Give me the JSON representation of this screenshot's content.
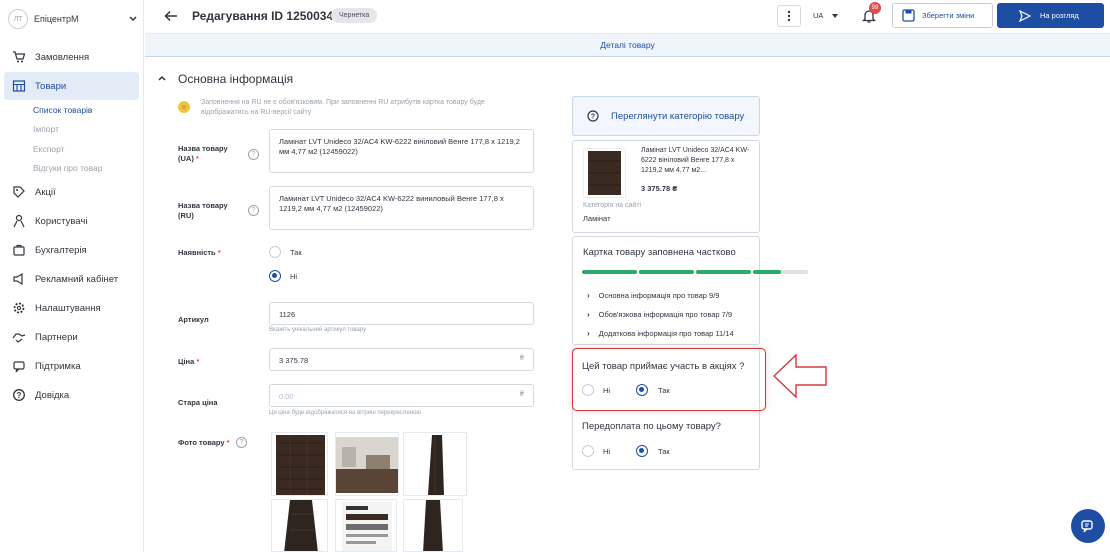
{
  "sidebar": {
    "avatar_initials": "ЛТ",
    "account_name": "ЕпіцентрМ",
    "items": [
      {
        "label": "Замовлення",
        "icon": "cart-icon"
      },
      {
        "label": "Товари",
        "icon": "catalog-icon"
      },
      {
        "label": "Акції",
        "icon": "discount-icon"
      },
      {
        "label": "Користувачі",
        "icon": "users-icon"
      },
      {
        "label": "Бухгалтерія",
        "icon": "accounting-icon"
      },
      {
        "label": "Рекламний кабінет",
        "icon": "megaphone-icon"
      },
      {
        "label": "Налаштування",
        "icon": "gear-icon"
      },
      {
        "label": "Партнери",
        "icon": "handshake-icon"
      },
      {
        "label": "Підтримка",
        "icon": "support-icon"
      },
      {
        "label": "Довідка",
        "icon": "help-icon"
      }
    ],
    "subitems": [
      "Список товарів",
      "Імпорт",
      "Експорт",
      "Відгуки про товар"
    ]
  },
  "header": {
    "title": "Редагування ID 12500348",
    "status_badge": "Чернетка",
    "lang": "UA",
    "notif_count": "99",
    "save_label": "Зберегти зміни",
    "submit_label": "На розгляд"
  },
  "tab": {
    "label": "Деталі товару"
  },
  "form": {
    "section_title": "Основна інформація",
    "ru_note": "Заповнення на RU не є обов'язковим. При заповненні RU атрибутів картка товару буде відображатись на RU-версії сайту",
    "name_ua_label": "Назва товару (UA)",
    "name_ua_value": "Ламінат LVT Unideco 32/AC4 KW-6222 вініловий Венге 177,8 х 1219,2 мм 4,77 м2 (12459022)",
    "name_ru_label": "Назва товару (RU)",
    "name_ru_value": "Ламинат LVT Unideco 32/AC4 KW-6222 виниловый Венге 177,8 х 1219,2 мм 4,77 м2 (12459022)",
    "availability_label": "Наявність",
    "availability_yes": "Так",
    "availability_no": "Ні",
    "sku_label": "Артикул",
    "sku_value": "1126",
    "sku_hint": "Вкажіть унікальний артикул товару",
    "price_label": "Ціна",
    "price_value": "3 375.78",
    "currency": "₴",
    "old_price_label": "Стара ціна",
    "old_price_placeholder": "0.00",
    "old_price_hint": "Ця ціна буде відображатися на вітрині перекресленою",
    "photo_label": "Фото товару"
  },
  "right": {
    "category_btn": "Переглянути категорію товару",
    "product_name": "Ламінат LVT Unideco 32/AC4 KW-6222 вініловий Венге 177,8 х 1219,2 мм 4,77 м2...",
    "product_price": "3 375.78 ₴",
    "category_caption": "Категорія на сайті",
    "category_value": "Ламінат",
    "completeness_title": "Картка товару заповнена частково",
    "completeness_segments": [
      1,
      1,
      1,
      0.5
    ],
    "sections": [
      "Основна інформація про товар 9/9",
      "Обов'язкова інформація про товар 7/9",
      "Додаткова інформація про товар 11/14"
    ],
    "promo_question": "Цей товар приймає участь в акціях ?",
    "promo_no": "Ні",
    "promo_yes": "Так",
    "prepay_question": "Передоплата по цьому товару?",
    "prepay_no": "Ні",
    "prepay_yes": "Так"
  },
  "colors": {
    "accent": "#1e4ea3",
    "highlight": "#d23a3a",
    "progress": "#2eaa6b"
  }
}
